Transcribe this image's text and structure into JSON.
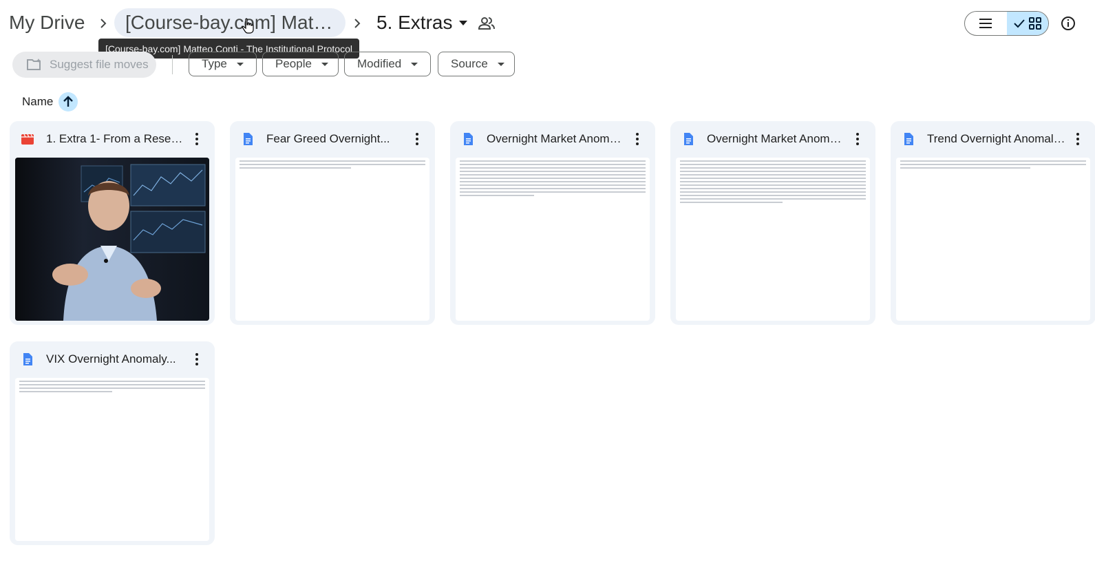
{
  "breadcrumb": {
    "root": "My Drive",
    "parent": "[Course-bay.com] Matt...",
    "current": "5. Extras"
  },
  "tooltip": "[Course-bay.com] Matteo Conti - The Institutional Protocol",
  "toolbar": {
    "suggest_label": "Suggest file moves",
    "filters": [
      "Type",
      "People",
      "Modified",
      "Source"
    ]
  },
  "sort": {
    "label": "Name",
    "direction": "ascending"
  },
  "files": [
    {
      "title": "1. Extra 1- From a Researc...",
      "kind": "video",
      "icon": "video-icon",
      "icon_color": "#ea4335"
    },
    {
      "title": "Fear Greed Overnight...",
      "kind": "doc",
      "icon": "doc-icon",
      "icon_color": "#4285f4"
    },
    {
      "title": "Overnight Market Anomal...",
      "kind": "doc",
      "icon": "doc-icon",
      "icon_color": "#4285f4"
    },
    {
      "title": "Overnight Market Anomal...",
      "kind": "doc",
      "icon": "doc-icon",
      "icon_color": "#4285f4"
    },
    {
      "title": "Trend Overnight Anomaly...",
      "kind": "doc",
      "icon": "doc-icon",
      "icon_color": "#4285f4"
    },
    {
      "title": "VIX Overnight Anomaly...",
      "kind": "doc",
      "icon": "doc-icon",
      "icon_color": "#4285f4"
    }
  ],
  "colors": {
    "accent": "#c2e7ff",
    "chip_border": "#747775",
    "card_bg": "#f0f4f9"
  }
}
